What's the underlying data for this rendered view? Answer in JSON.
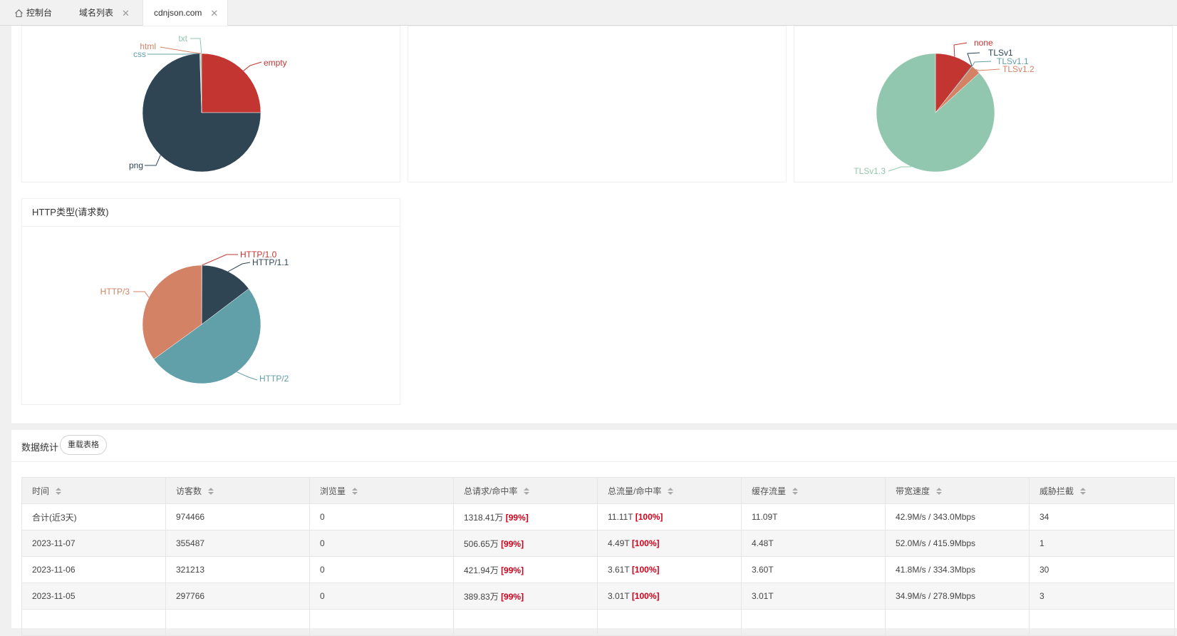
{
  "tabs": [
    {
      "label": "控制台",
      "home": true,
      "closable": false
    },
    {
      "label": "域名列表",
      "closable": true
    },
    {
      "label": "cdnjson.com",
      "closable": true,
      "active": true
    }
  ],
  "file_type_chart": {
    "chart_data": {
      "type": "pie",
      "slices": [
        {
          "label": "empty",
          "value": 25,
          "color": "#c23531"
        },
        {
          "label": "png",
          "value": 74.5,
          "color": "#2f4554"
        },
        {
          "label": "css",
          "value": 0.2,
          "color": "#61a0a8"
        },
        {
          "label": "html",
          "value": 0.2,
          "color": "#d48265"
        },
        {
          "label": "txt",
          "value": 0.1,
          "color": "#91c7ae"
        }
      ]
    }
  },
  "tls_chart": {
    "chart_data": {
      "type": "pie",
      "slices": [
        {
          "label": "none",
          "value": 10.5,
          "color": "#c23531"
        },
        {
          "label": "TLSv1",
          "value": 0.1,
          "color": "#2f4554"
        },
        {
          "label": "TLSv1.1",
          "value": 0.1,
          "color": "#61a0a8"
        },
        {
          "label": "TLSv1.2",
          "value": 2.6,
          "color": "#d48265"
        },
        {
          "label": "TLSv1.3",
          "value": 86.7,
          "color": "#91c7ae"
        }
      ]
    }
  },
  "http_chart": {
    "title": "HTTP类型(请求数)",
    "chart_data": {
      "type": "pie",
      "slices": [
        {
          "label": "HTTP/1.0",
          "value": 0.1,
          "color": "#c23531"
        },
        {
          "label": "HTTP/1.1",
          "value": 14.6,
          "color": "#2f4554"
        },
        {
          "label": "HTTP/2",
          "value": 50.3,
          "color": "#61a0a8"
        },
        {
          "label": "HTTP/3",
          "value": 35.0,
          "color": "#d48265"
        }
      ]
    }
  },
  "stats": {
    "title": "数据统计",
    "reload_label": "重载表格",
    "columns": [
      "时间",
      "访客数",
      "浏览量",
      "总请求/命中率",
      "总流量/命中率",
      "缓存流量",
      "带宽速度",
      "威胁拦截"
    ],
    "rows": [
      {
        "time": "合计(近3天)",
        "visitors": "974466",
        "views": "0",
        "requests": "1318.41万",
        "req_rate": "[99%]",
        "traffic": "11.11T",
        "traffic_rate": "[100%]",
        "cache": "11.09T",
        "bandwidth": "42.9M/s / 343.0Mbps",
        "threats": "34"
      },
      {
        "time": "2023-11-07",
        "visitors": "355487",
        "views": "0",
        "requests": "506.65万",
        "req_rate": "[99%]",
        "traffic": "4.49T",
        "traffic_rate": "[100%]",
        "cache": "4.48T",
        "bandwidth": "52.0M/s / 415.9Mbps",
        "threats": "1"
      },
      {
        "time": "2023-11-06",
        "visitors": "321213",
        "views": "0",
        "requests": "421.94万",
        "req_rate": "[99%]",
        "traffic": "3.61T",
        "traffic_rate": "[100%]",
        "cache": "3.60T",
        "bandwidth": "41.8M/s / 334.3Mbps",
        "threats": "30"
      },
      {
        "time": "2023-11-05",
        "visitors": "297766",
        "views": "0",
        "requests": "389.83万",
        "req_rate": "[99%]",
        "traffic": "3.01T",
        "traffic_rate": "[100%]",
        "cache": "3.01T",
        "bandwidth": "34.9M/s / 278.9Mbps",
        "threats": "3"
      }
    ]
  }
}
